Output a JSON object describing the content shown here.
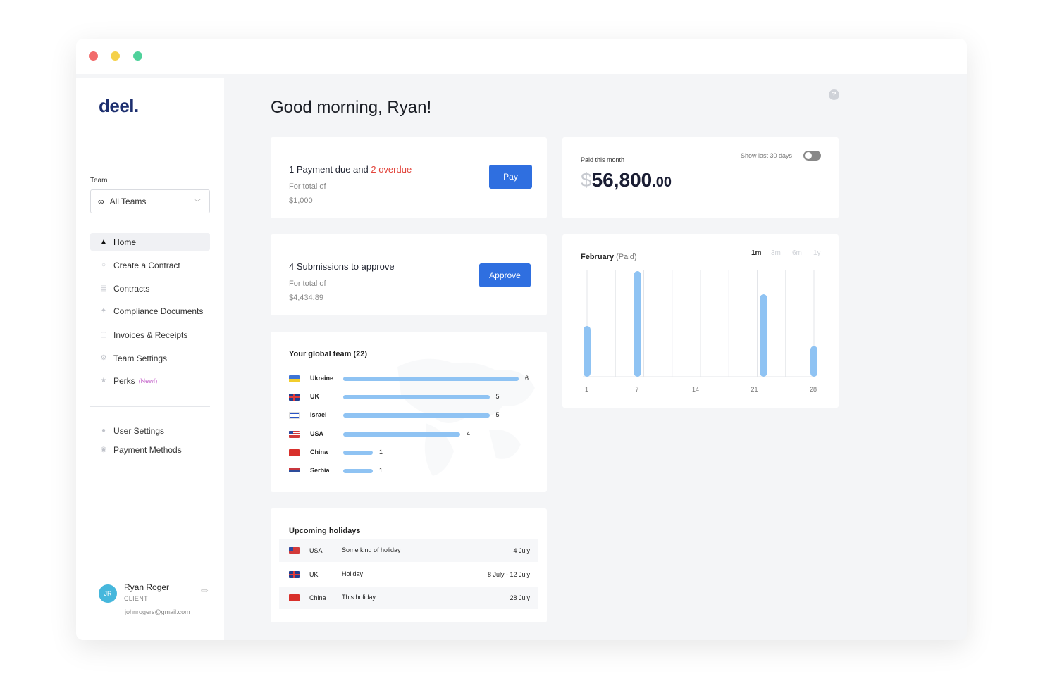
{
  "app": {
    "logo": "deel."
  },
  "sidebar": {
    "team_label": "Team",
    "team_select": "All Teams",
    "nav": [
      {
        "label": "Home",
        "icon": "home-icon"
      },
      {
        "label": "Create a Contract",
        "icon": "plus-circle-icon"
      },
      {
        "label": "Contracts",
        "icon": "document-icon"
      },
      {
        "label": "Compliance Documents",
        "icon": "pin-icon"
      },
      {
        "label": "Invoices & Receipts",
        "icon": "receipt-icon"
      },
      {
        "label": "Team Settings",
        "icon": "gear-icon"
      },
      {
        "label": "Perks",
        "icon": "star-icon",
        "badge": "(New!)"
      }
    ],
    "secondary_nav": [
      {
        "label": "User Settings",
        "icon": "user-icon"
      },
      {
        "label": "Payment Methods",
        "icon": "card-icon"
      }
    ],
    "user": {
      "initials": "JR",
      "name": "Ryan Roger",
      "role": "CLIENT",
      "email": "johnrogers@gmail.com"
    }
  },
  "main": {
    "greeting": "Good morning, Ryan!",
    "payment_card": {
      "prefix": "1 Payment due and ",
      "overdue": "2 overdue",
      "total_label": "For total of",
      "amount": "$1,000",
      "button": "Pay"
    },
    "submissions_card": {
      "title": "4 Submissions to approve",
      "total_label": "For total of",
      "amount": "$4,434.89",
      "button": "Approve"
    },
    "paid_card": {
      "label": "Paid this month",
      "currency": "$",
      "amount": "56,800",
      "cents": ".00",
      "toggle_label": "Show last 30 days",
      "toggle_on": false
    },
    "team_card": {
      "title": "Your global team (22)",
      "rows": [
        {
          "country": "Ukraine",
          "count": 6,
          "label": "6"
        },
        {
          "country": "UK",
          "count": 5,
          "label": "5"
        },
        {
          "country": "Israel",
          "count": 5,
          "label": "5"
        },
        {
          "country": "USA",
          "count": 4,
          "label": "4"
        },
        {
          "country": "China",
          "count": 1,
          "label": "1"
        },
        {
          "country": "Serbia",
          "count": 1,
          "label": "1"
        }
      ]
    },
    "holidays_card": {
      "title": "Upcoming holidays",
      "rows": [
        {
          "country": "USA",
          "name": "Some kind of holiday",
          "date": "4 July"
        },
        {
          "country": "UK",
          "name": "Holiday",
          "date": "8 July - 12 July"
        },
        {
          "country": "China",
          "name": "This holiday",
          "date": "28 July"
        }
      ]
    }
  },
  "chart_data": {
    "type": "bar",
    "title": "February",
    "subtitle": "(Paid)",
    "ranges": [
      "1m",
      "3m",
      "6m",
      "1y"
    ],
    "selected_range": "1m",
    "x_ticks": [
      1,
      7,
      14,
      21,
      28
    ],
    "x": [
      1,
      7,
      22,
      28
    ],
    "values": [
      48,
      100,
      78,
      29
    ],
    "ylim": [
      0,
      100
    ],
    "bar_color": "#8fc3f3",
    "grid": true
  },
  "colors": {
    "accent": "#2f6fe0",
    "overdue": "#e2453c",
    "bar": "#8fc3f3",
    "perks_badge": "#c05ac7"
  }
}
